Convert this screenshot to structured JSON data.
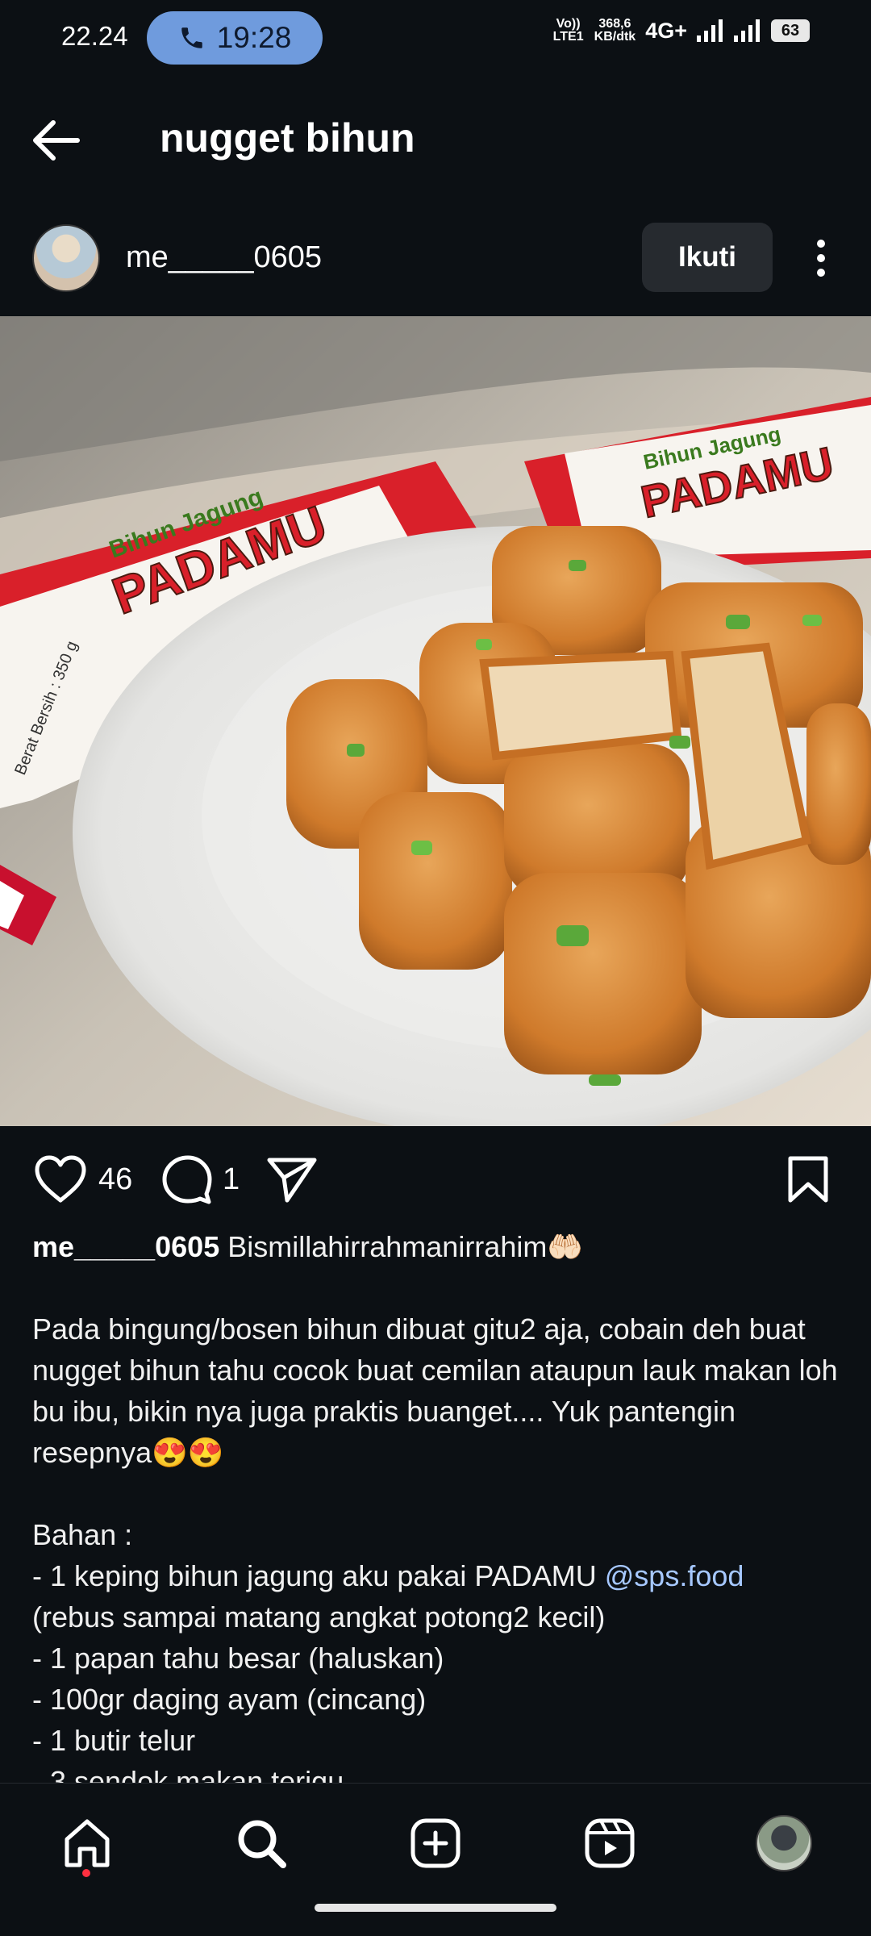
{
  "status_bar": {
    "time": "22.24",
    "call_time": "19:28",
    "volte": "Vo)) LTE1",
    "speed_value": "368,6",
    "speed_unit": "KB/dtk",
    "network": "4G+",
    "battery": "63"
  },
  "header": {
    "title": "nugget bihun"
  },
  "post": {
    "username": "me_____0605",
    "follow_label": "Ikuti",
    "likes": "46",
    "comments": "1",
    "caption": {
      "username": "me_____0605",
      "first_line": " Bismillahirrahmanirrahim🤲🏻",
      "paragraph": "Pada bingung/bosen bihun dibuat gitu2 aja, cobain deh buat nugget bihun tahu cocok buat cemilan ataupun lauk makan loh bu ibu, bikin nya juga praktis buanget.... Yuk pantengin resepnya😍😍",
      "bahan_title": "Bahan :",
      "item1_prefix": "- 1 keping bihun jagung aku pakai PADAMU ",
      "item1_mention": "@sps.food",
      "item1_suffix": "(rebus sampai matang angkat potong2 kecil)",
      "item2": "- 1 papan tahu besar (haluskan)",
      "item3": "- 100gr daging ayam (cincang)",
      "item4": "- 1 butir telur",
      "item5": "- 3 sendok makan terigu"
    }
  },
  "photo": {
    "package_brand": "PADAMU",
    "package_subbrand": "Bihun Jagung",
    "package_weight": "Berat Bersih : 350 g"
  },
  "colors": {
    "background": "#0c1014",
    "call_pill": "#6f9bdd",
    "follow_button": "#262a2f",
    "mention": "#a6c8ff",
    "notification_dot": "#ff3040"
  },
  "icons": {
    "back": "arrow-left-icon",
    "more": "more-vertical-icon",
    "like": "heart-icon",
    "comment": "comment-icon",
    "share": "send-icon",
    "save": "bookmark-icon",
    "nav": [
      "home-icon",
      "search-icon",
      "add-post-icon",
      "reels-icon",
      "profile-avatar"
    ]
  }
}
